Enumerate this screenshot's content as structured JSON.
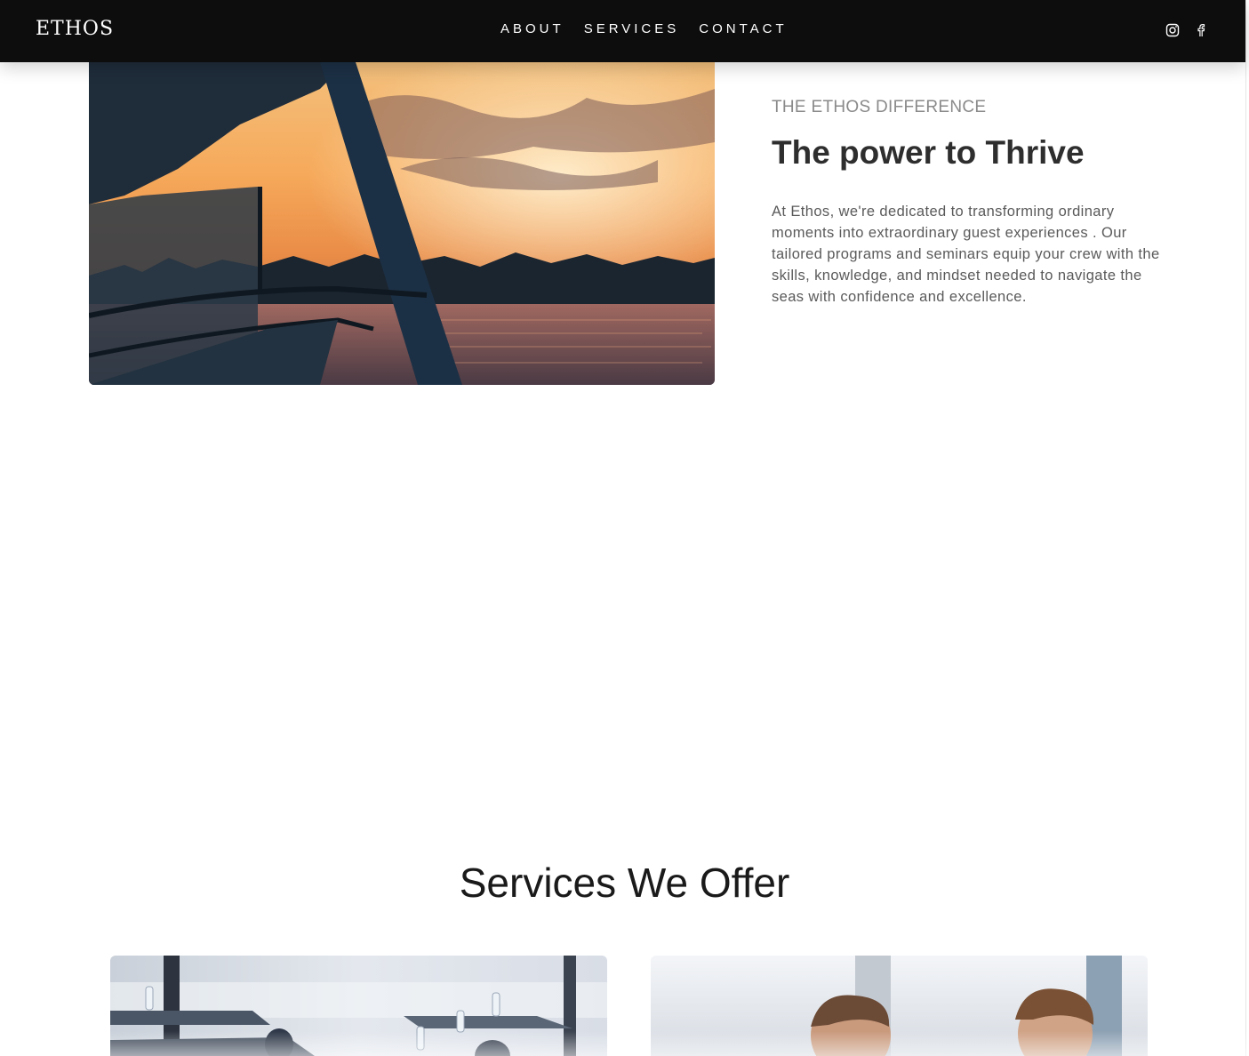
{
  "brand": {
    "logo_text": "ETHOS"
  },
  "nav": {
    "links": [
      "ABOUT",
      "SERVICES",
      "CONTACT"
    ]
  },
  "social": {
    "icons": [
      "instagram-icon",
      "facebook-icon"
    ]
  },
  "hero": {
    "eyebrow": "THE ETHOS DIFFERENCE",
    "title": "The power to Thrive",
    "body": "At Ethos, we're dedicated to transforming ordinary moments into extraordinary guest experiences . Our tailored programs and seminars equip your crew with the skills, knowledge, and mindset needed to navigate the seas with confidence and excellence."
  },
  "services": {
    "title": "Services We Offer"
  },
  "colors": {
    "navbar_bg": "#0d0d0d",
    "text_dark": "#2e2e2e",
    "text_muted": "#8a8a8a"
  }
}
